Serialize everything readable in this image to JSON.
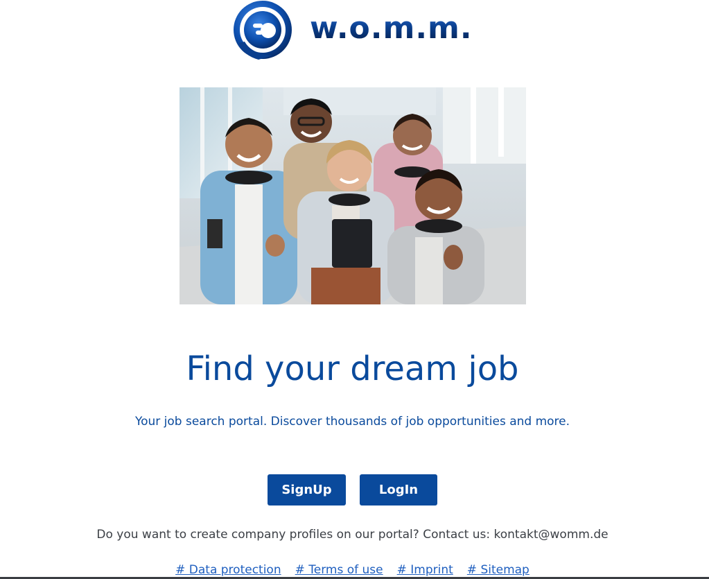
{
  "header": {
    "logo_text": "w.o.m.m.",
    "logo_icon": "womm-logo-icon"
  },
  "hero": {
    "image": "group-of-five-smiling-people-thumbs-up-photo"
  },
  "main": {
    "headline": "Find your dream job",
    "subline": "Your job search portal. Discover thousands of job opportunities and more.",
    "signup_label": "SignUp",
    "login_label": "LogIn",
    "contact_text": "Do you want to create company profiles on our portal? Contact us: kontakt@womm.de"
  },
  "footer": {
    "links": [
      "# Data protection",
      "# Terms of use",
      "# Imprint",
      "# Sitemap"
    ]
  },
  "colors": {
    "brand_blue": "#0a4a9c",
    "link_blue": "#1f5fbf",
    "text_gray": "#3b3f45"
  }
}
